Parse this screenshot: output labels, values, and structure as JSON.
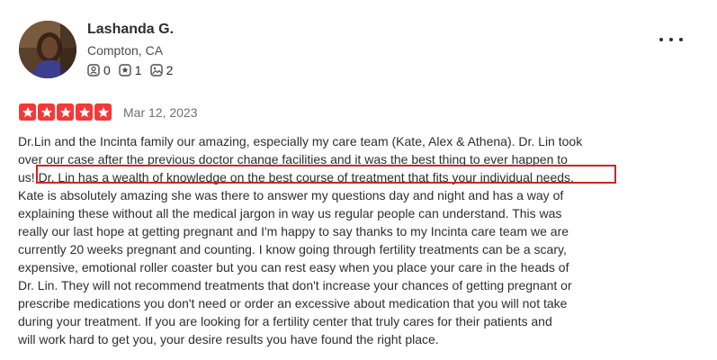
{
  "reviewer": {
    "name": "Lashanda G.",
    "location": "Compton, CA",
    "friends_count": "0",
    "reviews_count": "1",
    "photos_count": "2"
  },
  "review": {
    "rating": 5,
    "rating_color": "#f43939",
    "date": "Mar 12, 2023",
    "lines": [
      "Dr.Lin and the Incinta family our amazing, especially my care team (Kate, Alex & Athena). Dr. Lin took",
      "over our case after the previous doctor change facilities and it was the best thing to ever happen to",
      "us! Dr. Lin has a wealth of knowledge on the best course of treatment that fits your individual needs.",
      "Kate is absolutely amazing she was there to answer my questions day and night and has a way of",
      "explaining these without all the medical jargon in way us regular people can understand. This was",
      "really our last hope at getting pregnant and I'm happy to say thanks to my Incinta care team we are",
      "currently 20 weeks pregnant and counting. I know going through fertility treatments can be a scary,",
      "expensive, emotional roller coaster but you can rest easy when you place your care in the heads of",
      "Dr. Lin. They will not recommend treatments that don't increase your chances of getting pregnant or",
      "prescribe medications you don't need or order an excessive about medication that you will not take",
      "during your treatment. If you are looking for a fertility center that truly cares for their patients and",
      "will work hard to get you, your desire results you have found the right place."
    ],
    "highlight_color": "#d32323"
  },
  "icons": {
    "friends": "friends-icon",
    "reviews": "review-star-icon",
    "photos": "photo-icon",
    "more": "more-options-icon",
    "star": "star-icon"
  }
}
